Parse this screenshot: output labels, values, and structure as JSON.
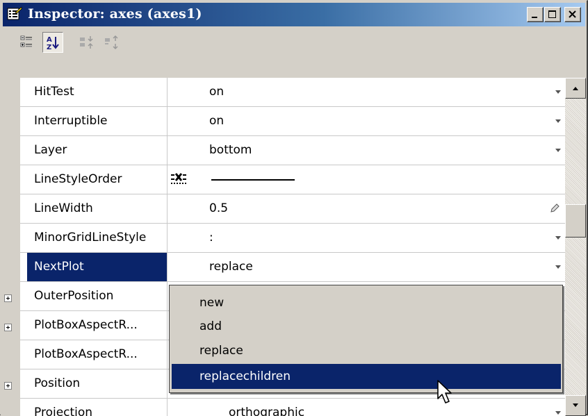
{
  "window": {
    "title": "Inspector: axes (axes1)",
    "accent": "#0a246a"
  },
  "toolbar": {
    "buttons": [
      {
        "name": "categorized-view-icon",
        "pressed": false
      },
      {
        "name": "alphabetical-sort-icon",
        "pressed": true
      },
      {
        "name": "expand-all-icon",
        "pressed": false
      },
      {
        "name": "collapse-all-icon",
        "pressed": false
      }
    ]
  },
  "properties": [
    {
      "name": "HitTest",
      "value": "on",
      "expandable": false,
      "control": "dropdown"
    },
    {
      "name": "Interruptible",
      "value": "on",
      "expandable": false,
      "control": "dropdown"
    },
    {
      "name": "Layer",
      "value": "bottom",
      "expandable": false,
      "control": "dropdown"
    },
    {
      "name": "LineStyleOrder",
      "value": "",
      "expandable": false,
      "control": "linestyle"
    },
    {
      "name": "LineWidth",
      "value": "0.5",
      "expandable": false,
      "control": "edit"
    },
    {
      "name": "MinorGridLineStyle",
      "value": ":",
      "expandable": false,
      "control": "dropdown"
    },
    {
      "name": "NextPlot",
      "value": "replace",
      "expandable": false,
      "control": "dropdown",
      "selected": true
    },
    {
      "name": "OuterPosition",
      "value": "",
      "expandable": true
    },
    {
      "name": "PlotBoxAspectR...",
      "value": "",
      "expandable": true
    },
    {
      "name": "PlotBoxAspectR...",
      "value": "",
      "expandable": false
    },
    {
      "name": "Position",
      "value": "",
      "expandable": true
    },
    {
      "name": "Projection",
      "value": "orthographic",
      "expandable": false
    }
  ],
  "dropdown": {
    "options": [
      "new",
      "add",
      "replace",
      "replacechildren"
    ],
    "highlighted": "replacechildren"
  },
  "scrollbar": {
    "position_fraction": 0.5
  }
}
